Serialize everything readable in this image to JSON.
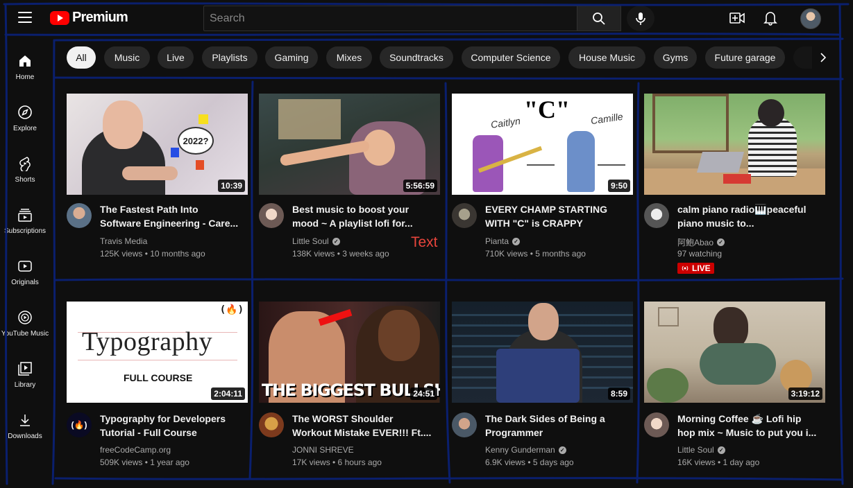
{
  "header": {
    "brand": "Premium",
    "search_placeholder": "Search"
  },
  "sidebar": {
    "items": [
      {
        "label": "Home",
        "icon": "home-icon"
      },
      {
        "label": "Explore",
        "icon": "compass-icon"
      },
      {
        "label": "Shorts",
        "icon": "shorts-icon"
      },
      {
        "label": "Subscriptions",
        "icon": "subscriptions-icon"
      },
      {
        "label": "Originals",
        "icon": "originals-icon"
      },
      {
        "label": "YouTube Music",
        "icon": "music-icon"
      },
      {
        "label": "Library",
        "icon": "library-icon"
      },
      {
        "label": "Downloads",
        "icon": "download-icon"
      }
    ]
  },
  "chips": [
    "All",
    "Music",
    "Live",
    "Playlists",
    "Gaming",
    "Mixes",
    "Soundtracks",
    "Computer Science",
    "House Music",
    "Gyms",
    "Future garage"
  ],
  "videos": [
    {
      "title1": "The Fastest Path Into",
      "title2": "Software Engineering - Care...",
      "channel": "Travis Media",
      "meta": "125K views • 10 months ago",
      "duration": "10:39",
      "thumb_text": "2022?"
    },
    {
      "title1": "Best music to boost your",
      "title2": "mood ~ A playlist lofi for...",
      "channel": "Little Soul",
      "meta": "138K views • 3 weeks ago",
      "duration": "5:56:59"
    },
    {
      "title1": "EVERY CHAMP STARTING",
      "title2": "WITH \"C\" is CRAPPY",
      "channel": "Pianta",
      "meta": "710K views • 5 months ago",
      "duration": "9:50",
      "thumb_big": "\"C\"",
      "thumb_left": "Caitlyn",
      "thumb_right": "Camille"
    },
    {
      "title1": "calm piano radio🎹peaceful",
      "title2": "piano music to...",
      "channel": "阿鮑Abao",
      "meta": "97 watching",
      "live": "LIVE"
    },
    {
      "title1": "Typography for Developers",
      "title2": "Tutorial - Full Course",
      "channel": "freeCodeCamp.org",
      "meta": "509K views • 1 year ago",
      "duration": "2:04:11",
      "thumb_word": "Typography",
      "thumb_sub": "FULL COURSE"
    },
    {
      "title1": "The WORST Shoulder",
      "title2": "Workout Mistake EVER!!! Ft....",
      "channel": "JONNI SHREVE",
      "meta": "17K views • 6 hours ago",
      "duration": "24:51",
      "thumb_caption": "THE BIGGEST BULLSH!T"
    },
    {
      "title1": "The Dark Sides of Being a",
      "title2": "Programmer",
      "channel": "Kenny Gunderman",
      "meta": "6.9K views • 5 days ago",
      "duration": "8:59"
    },
    {
      "title1": "Morning Coffee ☕ Lofi hip",
      "title2": "hop mix ~ Music to put you i...",
      "channel": "Little Soul",
      "meta": "16K views • 1 day ago",
      "duration": "3:19:12"
    }
  ],
  "annotation_text": "Text",
  "colors": {
    "annotation": "#0a1f6e",
    "live": "#cc0000",
    "brand": "#ff0000"
  }
}
